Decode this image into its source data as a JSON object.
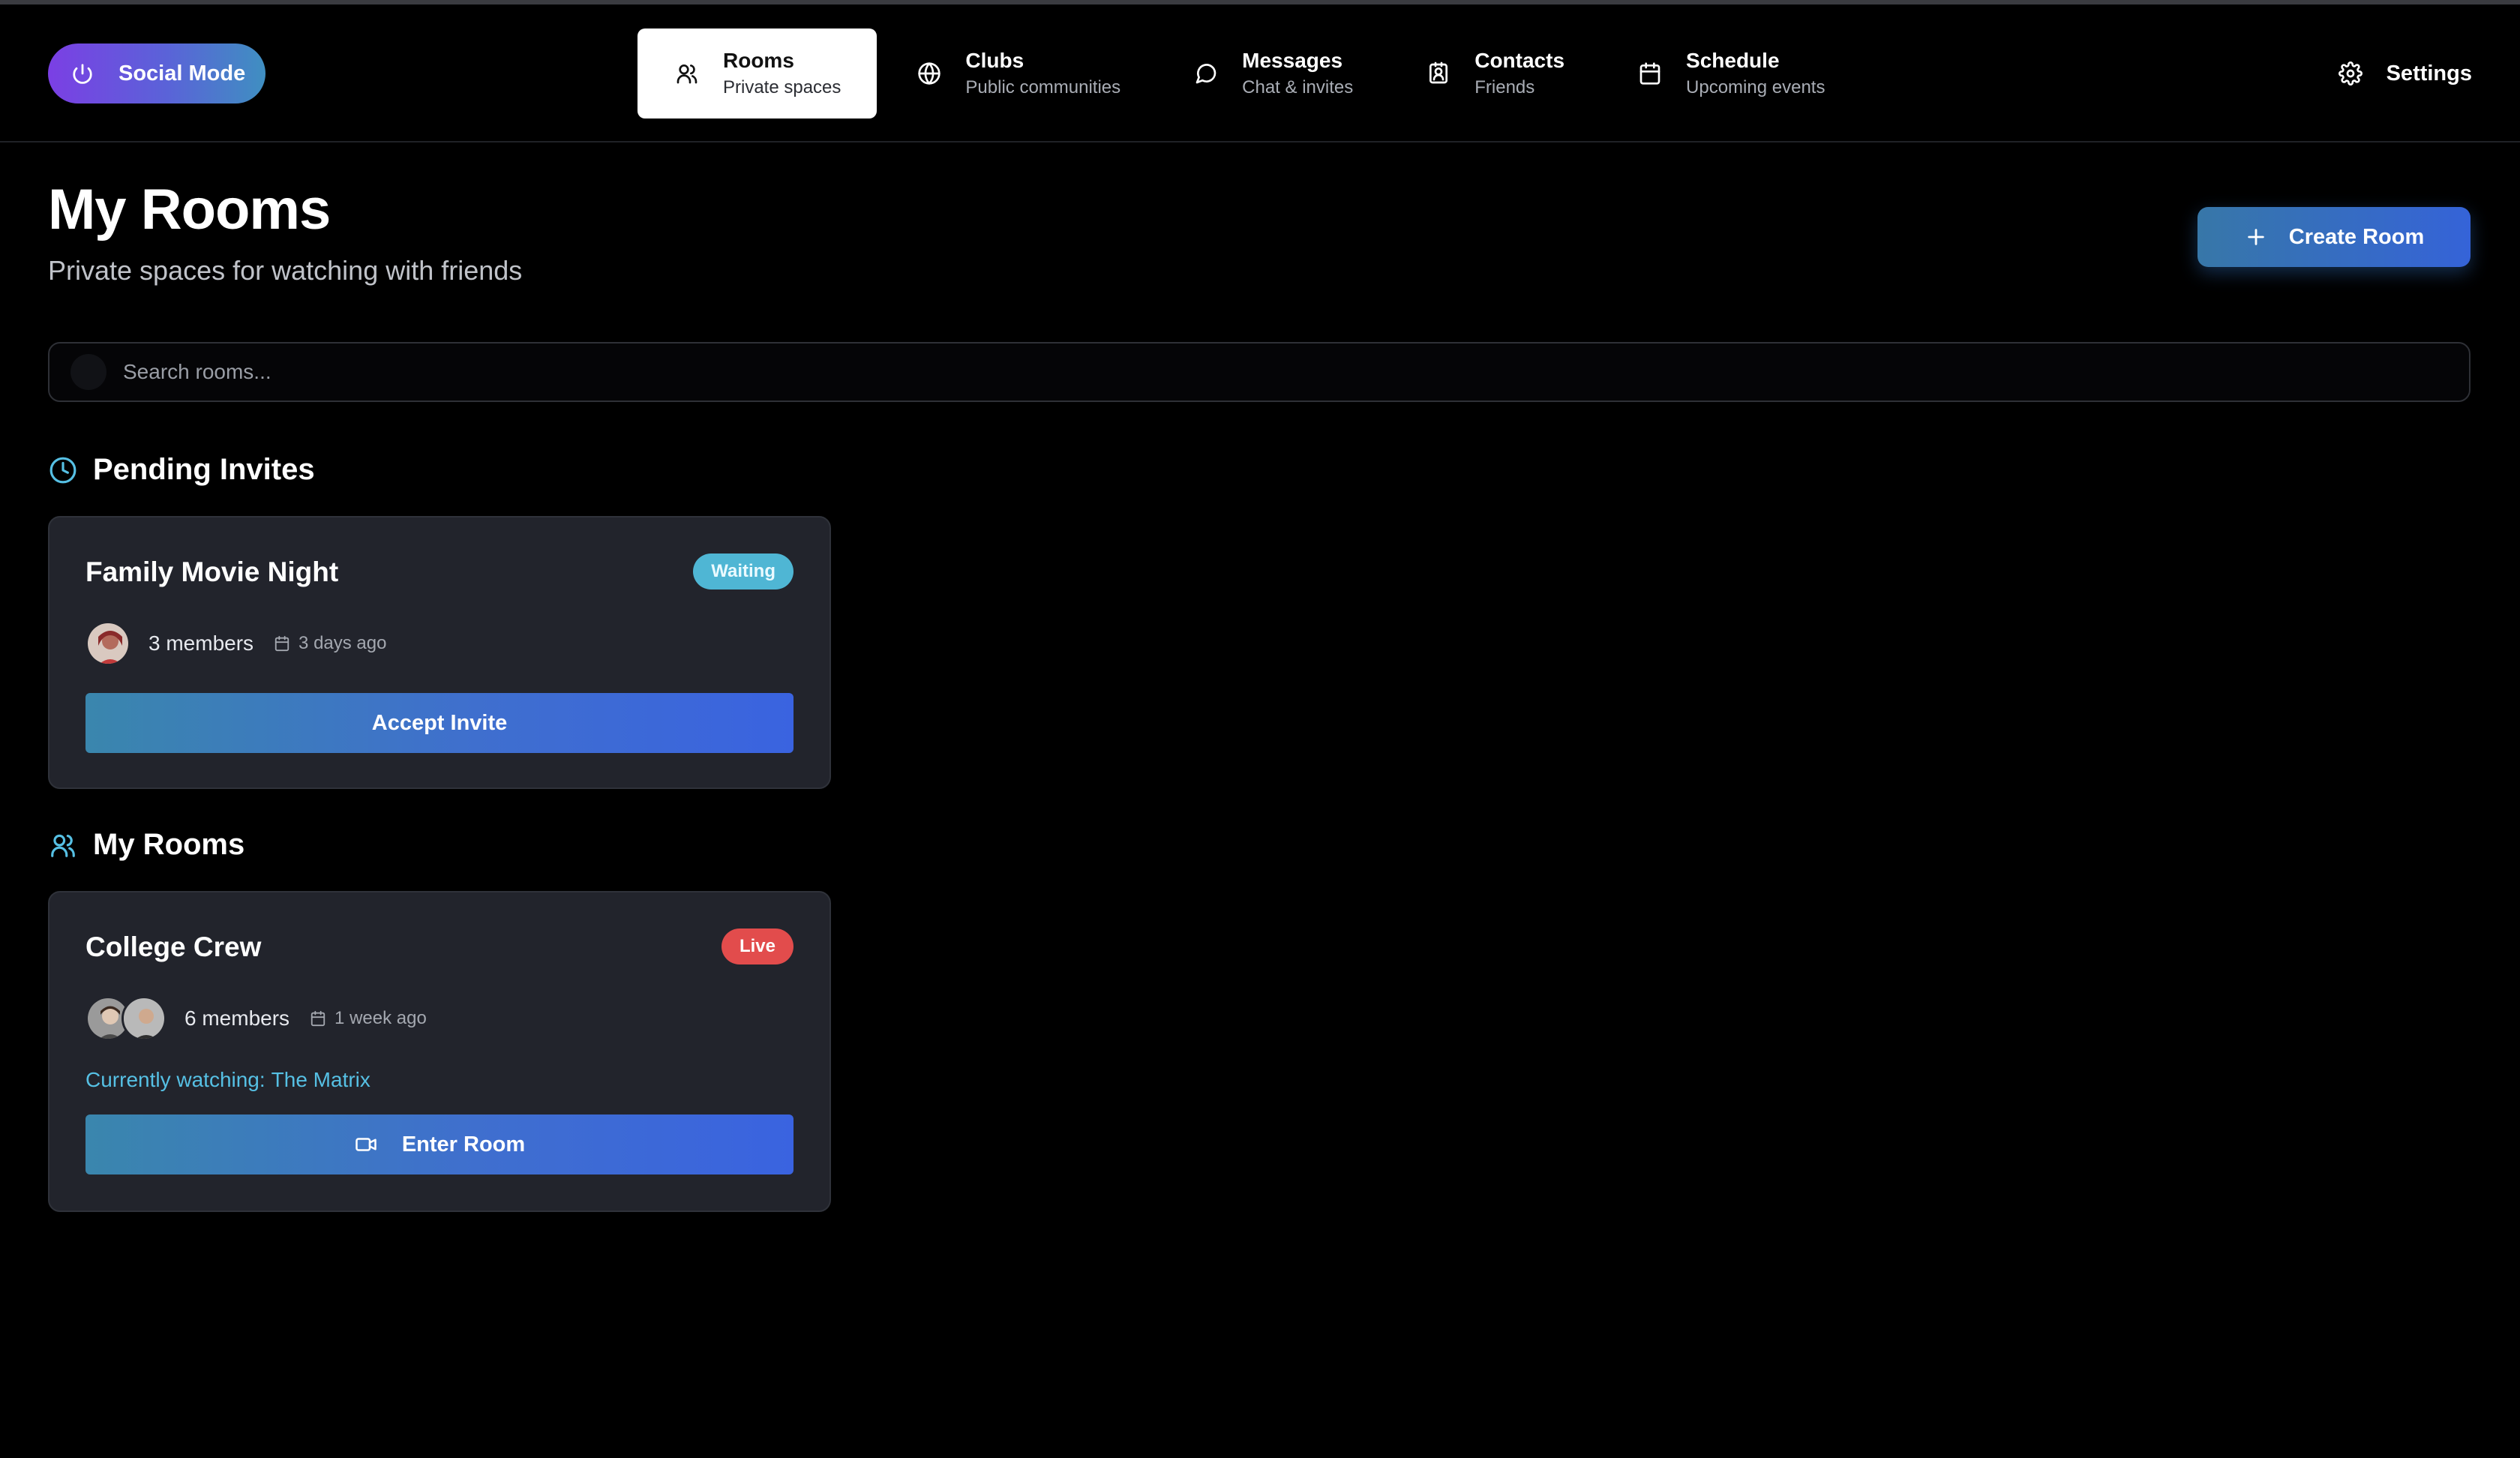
{
  "header": {
    "social_mode_label": "Social Mode",
    "nav": [
      {
        "title": "Rooms",
        "subtitle": "Private spaces",
        "icon": "users-icon",
        "active": true
      },
      {
        "title": "Clubs",
        "subtitle": "Public communities",
        "icon": "globe-icon",
        "active": false
      },
      {
        "title": "Messages",
        "subtitle": "Chat & invites",
        "icon": "message-circle-icon",
        "active": false
      },
      {
        "title": "Contacts",
        "subtitle": "Friends",
        "icon": "contact-icon",
        "active": false
      },
      {
        "title": "Schedule",
        "subtitle": "Upcoming events",
        "icon": "calendar-icon",
        "active": false
      }
    ],
    "settings_label": "Settings"
  },
  "page": {
    "title": "My Rooms",
    "subtitle": "Private spaces for watching with friends",
    "create_label": "Create Room"
  },
  "search": {
    "placeholder": "Search rooms..."
  },
  "pending": {
    "heading": "Pending Invites",
    "cards": [
      {
        "title": "Family Movie Night",
        "badge": "Waiting",
        "members": "3 members",
        "date": "3 days ago",
        "action": "Accept Invite"
      }
    ]
  },
  "rooms": {
    "heading": "My Rooms",
    "cards": [
      {
        "title": "College Crew",
        "badge": "Live",
        "members": "6 members",
        "date": "1 week ago",
        "watching_prefix": "Currently watching:",
        "watching_title": "The Matrix",
        "action": "Enter Room"
      }
    ]
  },
  "colors": {
    "accent": "#3a63e0",
    "waiting": "#4fb6d4",
    "live": "#e24c4c",
    "watching": "#56c0e4",
    "social_gradient_start": "#7b3fe4"
  }
}
